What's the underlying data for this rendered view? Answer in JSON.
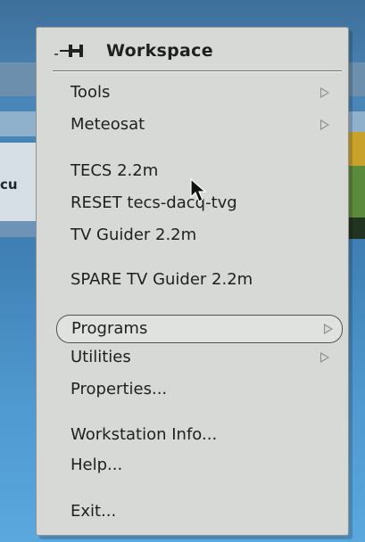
{
  "menu": {
    "title": "Workspace",
    "items": [
      {
        "label": "Tools",
        "submenu": true
      },
      {
        "label": "Meteosat",
        "submenu": true
      },
      {
        "label": "TECS 2.2m",
        "submenu": false
      },
      {
        "label": "RESET tecs-dacq-tvg",
        "submenu": false
      },
      {
        "label": "TV Guider 2.2m",
        "submenu": false
      },
      {
        "label": "SPARE TV Guider 2.2m",
        "submenu": false
      },
      {
        "label": "Programs",
        "submenu": true,
        "selected": true
      },
      {
        "label": "Utilities",
        "submenu": true
      },
      {
        "label": "Properties...",
        "submenu": false
      },
      {
        "label": "Workstation Info...",
        "submenu": false
      },
      {
        "label": "Help...",
        "submenu": false
      },
      {
        "label": "Exit...",
        "submenu": false
      }
    ]
  },
  "background": {
    "fragment_label": "cu"
  },
  "colors": {
    "menu_bg": "#d6d9d6",
    "desktop": "#4a86b8"
  }
}
